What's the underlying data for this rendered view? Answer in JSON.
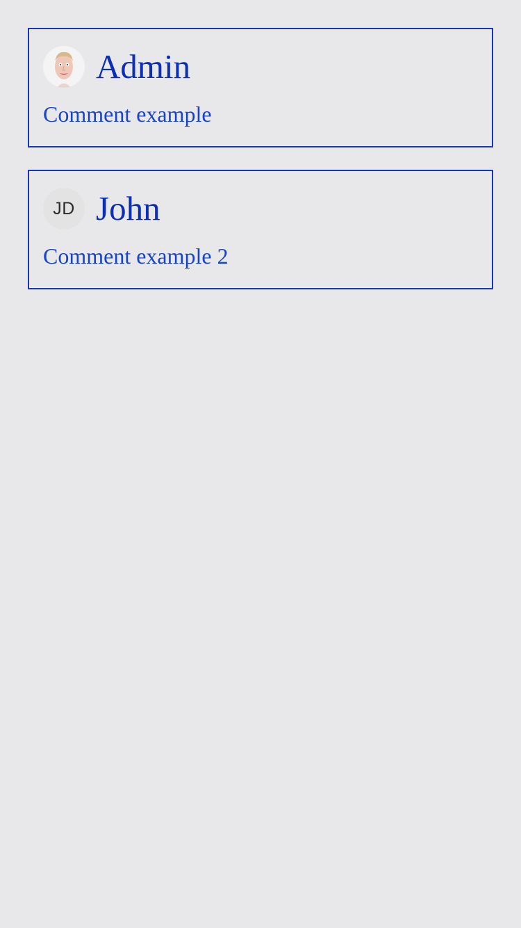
{
  "comments": [
    {
      "author": "Admin",
      "avatar": {
        "type": "photo",
        "icon": "user-photo-icon"
      },
      "text": "Comment example"
    },
    {
      "author": "John",
      "avatar": {
        "type": "initials",
        "initials": "JD"
      },
      "text": "Comment example 2"
    }
  ],
  "colors": {
    "background": "#e8e8ea",
    "border": "#1537b8",
    "name": "#0a2fb6",
    "comment": "#1744c8"
  }
}
